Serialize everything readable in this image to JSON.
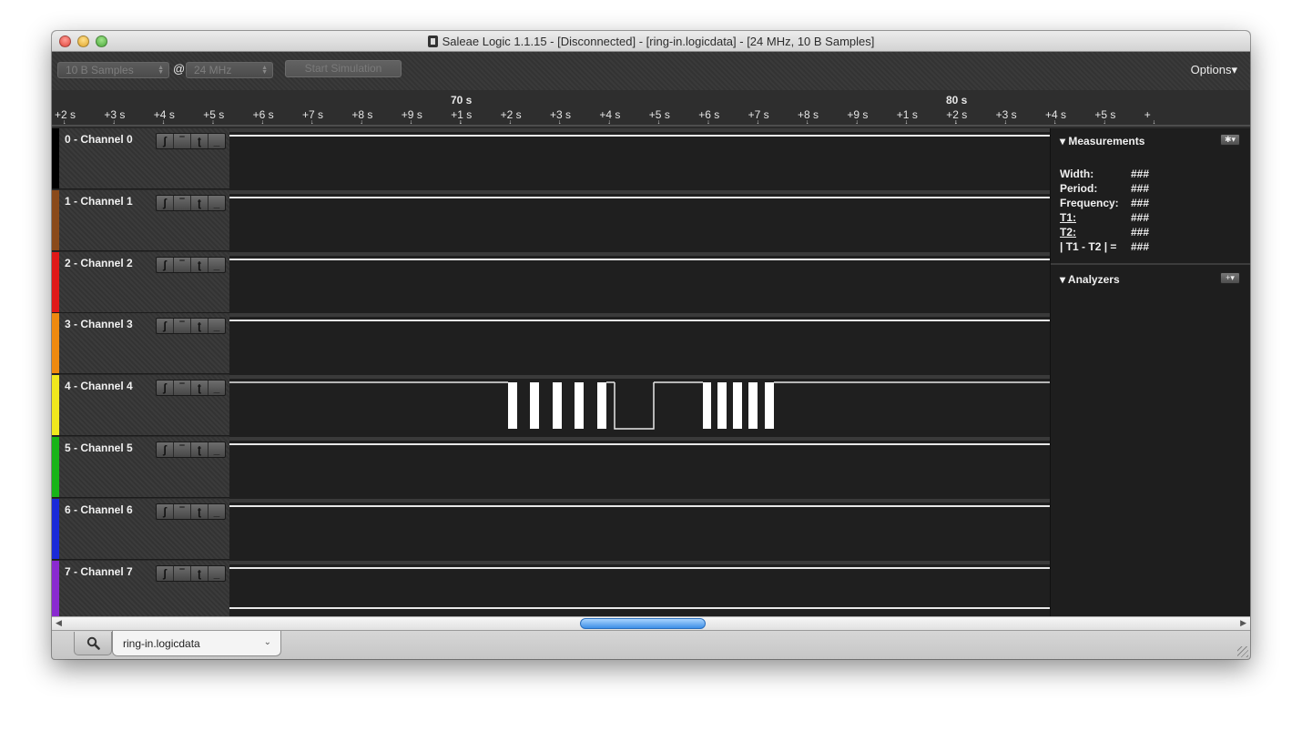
{
  "window": {
    "title": "Saleae Logic 1.1.15 - [Disconnected] - [ring-in.logicdata] - [24 MHz, 10 B Samples]"
  },
  "toolbar": {
    "samples_value": "10 B Samples",
    "at_symbol": "@",
    "rate_value": "24 MHz",
    "start_label": "Start Simulation",
    "options_label": "Options▾"
  },
  "timeline": {
    "major_labels": [
      "70 s",
      "80 s"
    ],
    "ticks": [
      "+2 s",
      "+3 s",
      "+4 s",
      "+5 s",
      "+6 s",
      "+7 s",
      "+8 s",
      "+9 s",
      "+1 s",
      "+2 s",
      "+3 s",
      "+4 s",
      "+5 s",
      "+6 s",
      "+7 s",
      "+8 s",
      "+9 s",
      "+1 s",
      "+2 s",
      "+3 s",
      "+4 s",
      "+5 s",
      "+"
    ]
  },
  "channels": [
    {
      "name": "0 - Channel 0",
      "color": "#000000"
    },
    {
      "name": "1 - Channel 1",
      "color": "#8a4a1a"
    },
    {
      "name": "2 - Channel 2",
      "color": "#e01818"
    },
    {
      "name": "3 - Channel 3",
      "color": "#ef8a10"
    },
    {
      "name": "4 - Channel 4",
      "color": "#f0e81e"
    },
    {
      "name": "5 - Channel 5",
      "color": "#18b418"
    },
    {
      "name": "6 - Channel 6",
      "color": "#1a2ad8"
    },
    {
      "name": "7 - Channel 7",
      "color": "#8a2ad0"
    }
  ],
  "trigger_glyphs": [
    "ʃ",
    "‾",
    "ʈ",
    "_"
  ],
  "measurements": {
    "title": "Measurements",
    "rows": [
      {
        "label": "Width:",
        "value": "###"
      },
      {
        "label": "Period:",
        "value": "###"
      },
      {
        "label": "Frequency:",
        "value": "###"
      },
      {
        "label": "T1:",
        "value": "###"
      },
      {
        "label": "T2:",
        "value": "###"
      },
      {
        "label": "| T1 - T2 | =",
        "value": "###"
      }
    ]
  },
  "analyzers": {
    "title": "Analyzers"
  },
  "tabs": {
    "file_tab_label": "ring-in.logicdata",
    "chevron": "⌄"
  },
  "icons": {
    "search": "search-icon",
    "gear": "gear-icon",
    "add": "plus-icon"
  }
}
